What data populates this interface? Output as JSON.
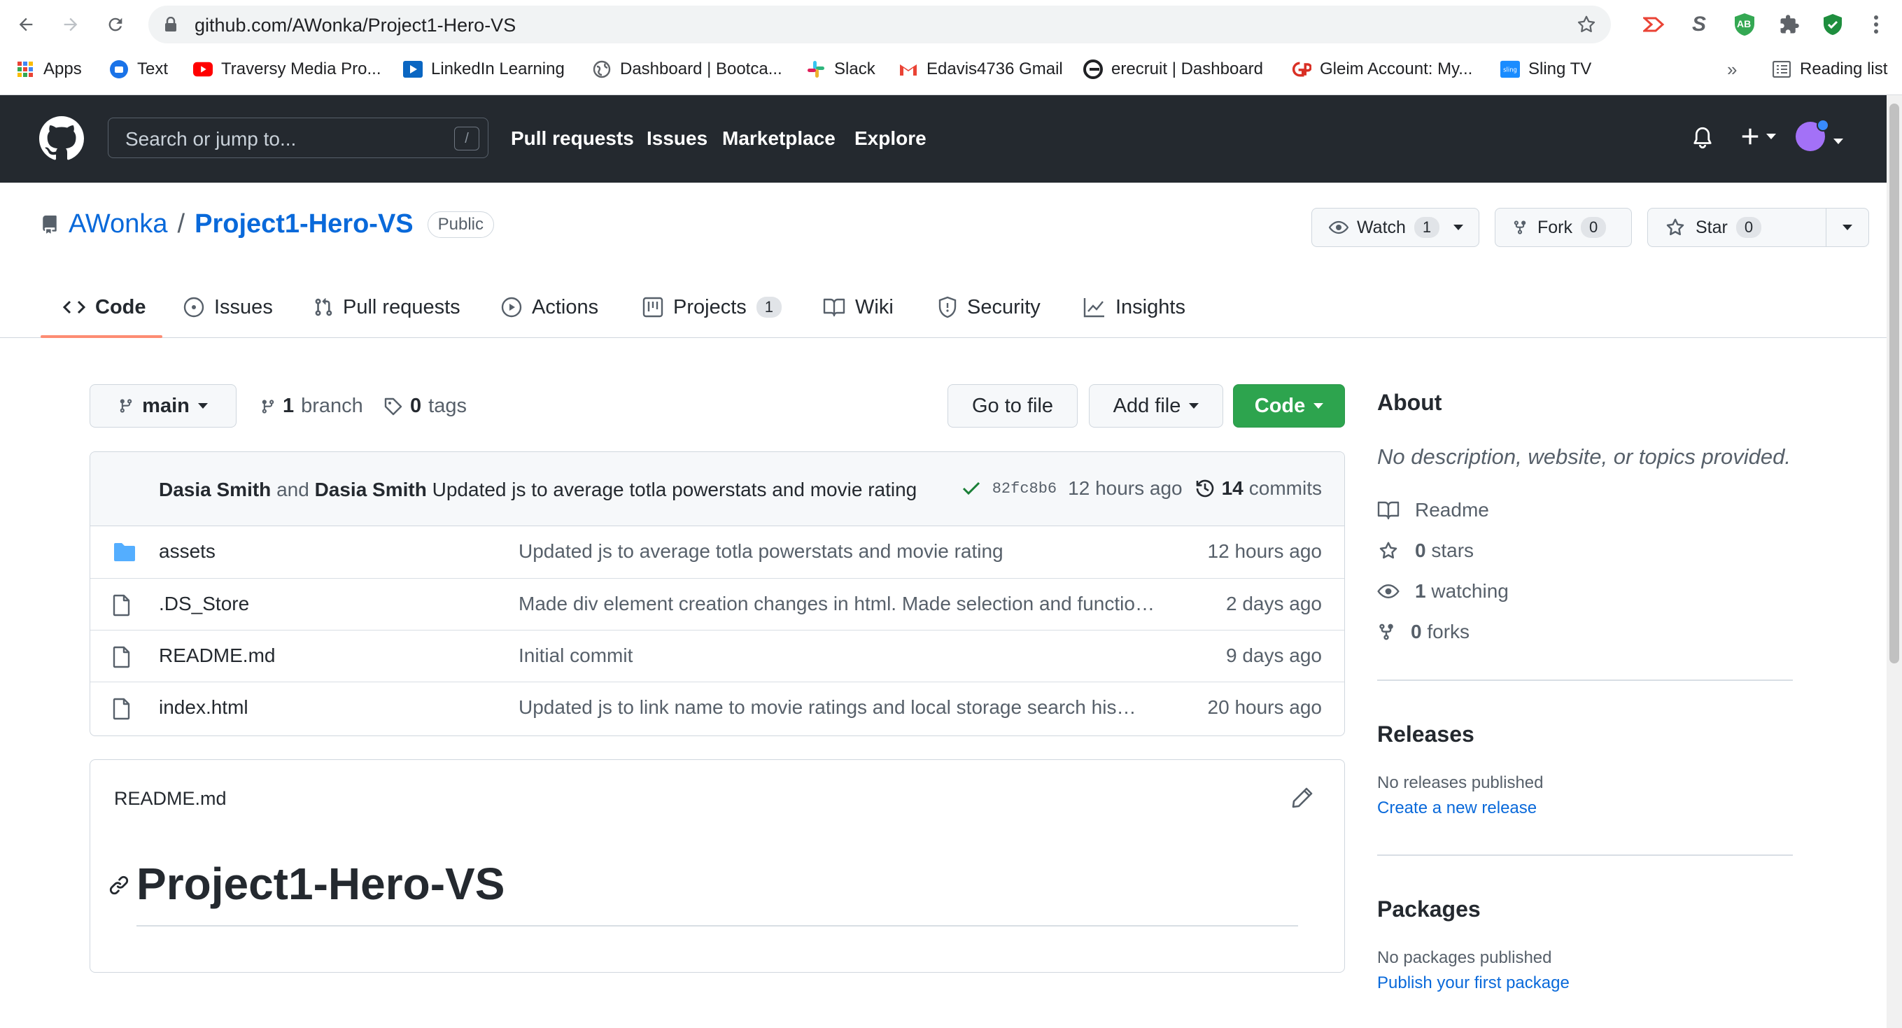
{
  "browser": {
    "url": "github.com/AWonka/Project1-Hero-VS",
    "bookmarks": [
      {
        "label": "Apps",
        "icon": "apps-grid-icon"
      },
      {
        "label": "Text",
        "icon": "text-icon"
      },
      {
        "label": "Traversy Media Pro...",
        "icon": "youtube-icon"
      },
      {
        "label": "LinkedIn Learning",
        "icon": "linkedin-learning-icon"
      },
      {
        "label": "Dashboard | Bootca...",
        "icon": "globe-icon"
      },
      {
        "label": "Slack",
        "icon": "slack-icon"
      },
      {
        "label": "Edavis4736 Gmail",
        "icon": "gmail-icon"
      },
      {
        "label": "erecruit | Dashboard",
        "icon": "erecruit-icon"
      },
      {
        "label": "Gleim Account: My...",
        "icon": "gleim-icon"
      },
      {
        "label": "Sling TV",
        "icon": "sling-icon"
      }
    ],
    "more": "»",
    "reading_list": "Reading list",
    "extensions": {
      "ab_label": "AB",
      "s_label": "S"
    }
  },
  "gh": {
    "search_placeholder": "Search or jump to...",
    "search_key": "/",
    "nav": [
      "Pull requests",
      "Issues",
      "Marketplace",
      "Explore"
    ]
  },
  "repo": {
    "owner": "AWonka",
    "sep": "/",
    "name": "Project1-Hero-VS",
    "visibility": "Public",
    "watch": {
      "label": "Watch",
      "count": "1"
    },
    "fork": {
      "label": "Fork",
      "count": "0"
    },
    "star": {
      "label": "Star",
      "count": "0"
    },
    "tabs": [
      {
        "label": "Code",
        "icon": "code-icon",
        "active": true
      },
      {
        "label": "Issues",
        "icon": "issue-icon"
      },
      {
        "label": "Pull requests",
        "icon": "pull-request-icon"
      },
      {
        "label": "Actions",
        "icon": "play-icon"
      },
      {
        "label": "Projects",
        "icon": "project-icon",
        "count": "1"
      },
      {
        "label": "Wiki",
        "icon": "book-icon"
      },
      {
        "label": "Security",
        "icon": "shield-icon"
      },
      {
        "label": "Insights",
        "icon": "graph-icon"
      }
    ]
  },
  "toolbar": {
    "branch": "main",
    "branches_count": "1",
    "branches_label": "branch",
    "tags_count": "0",
    "tags_label": "tags",
    "go_to_file": "Go to file",
    "add_file": "Add file",
    "code": "Code"
  },
  "commit": {
    "author1": "Dasia Smith",
    "and": "and",
    "author2": "Dasia Smith",
    "message": "Updated js to average totla powerstats and movie rating",
    "sha": "82fc8b6",
    "time": "12 hours ago",
    "count": "14",
    "count_label": "commits"
  },
  "files": [
    {
      "name": "assets",
      "type": "folder",
      "message": "Updated js to average totla powerstats and movie rating",
      "date": "12 hours ago"
    },
    {
      "name": ".DS_Store",
      "type": "file",
      "message": "Made div element creation changes in html. Made selection and functio…",
      "date": "2 days ago"
    },
    {
      "name": "README.md",
      "type": "file",
      "message": "Initial commit",
      "date": "9 days ago"
    },
    {
      "name": "index.html",
      "type": "file",
      "message": "Updated js to link name to movie ratings and local storage search his…",
      "date": "20 hours ago"
    }
  ],
  "readme": {
    "label": "README.md",
    "heading": "Project1-Hero-VS"
  },
  "about": {
    "title": "About",
    "description": "No description, website, or topics provided.",
    "readme": "Readme",
    "stars_count": "0",
    "stars_label": "stars",
    "watching_count": "1",
    "watching_label": "watching",
    "forks_count": "0",
    "forks_label": "forks"
  },
  "releases": {
    "title": "Releases",
    "empty": "No releases published",
    "link": "Create a new release"
  },
  "packages": {
    "title": "Packages",
    "empty": "No packages published",
    "link": "Publish your first package"
  },
  "colors": {
    "header_bg": "#24292f",
    "link": "#0969da",
    "green": "#2da44e",
    "tab_underline": "#fd8c73",
    "folder": "#54aeff"
  }
}
